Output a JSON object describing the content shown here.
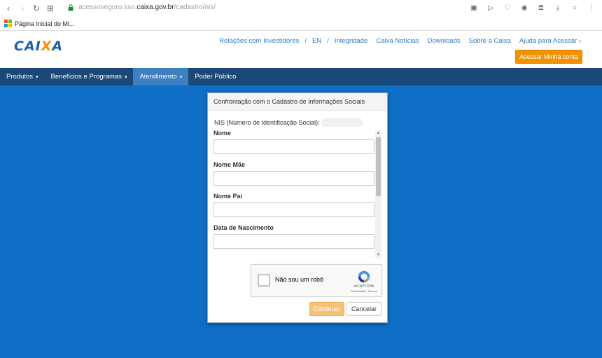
{
  "browser": {
    "url_prefix": "acessoseguro.sso.",
    "url_host": "caixa.gov.br",
    "url_path": "/cadastro/nis/",
    "bookmark_label": "Página Inicial do Mi..."
  },
  "header": {
    "logo_text_a": "CAI",
    "logo_text_x": "X",
    "logo_text_b": "A",
    "links": [
      "Relações com Investidores",
      "EN",
      "Integridade",
      "Caixa Notícias",
      "Downloads",
      "Sobre a Caixa",
      "Ajuda para Acessar ›"
    ],
    "separator": "/",
    "access_button": "Acessar Minha conta"
  },
  "nav": {
    "items": [
      {
        "label": "Produtos",
        "caret": "▾"
      },
      {
        "label": "Benefícios e Programas",
        "caret": "▾"
      },
      {
        "label": "Atendimento",
        "caret": "▾"
      },
      {
        "label": "Poder Público",
        "caret": ""
      }
    ]
  },
  "modal": {
    "title": "Confrontação com o Cadastro de Informações Sociais",
    "nis_label": "NIS (Número de Identificação Social):",
    "fields": [
      {
        "label": "Nome",
        "value": ""
      },
      {
        "label": "Nome Mãe",
        "value": ""
      },
      {
        "label": "Nome Pai",
        "value": ""
      },
      {
        "label": "Data de Nascimento",
        "value": ""
      }
    ],
    "recaptcha": {
      "label": "Não sou um robô",
      "brand": "reCAPTCHA",
      "terms": "Privacidade - Termos"
    },
    "continue_button": "Continuar",
    "cancel_button": "Cancelar"
  },
  "colors": {
    "brand_blue": "#1c60ab",
    "brand_orange": "#f39200",
    "navbar": "#1a4878",
    "background": "#0f6fc6"
  }
}
